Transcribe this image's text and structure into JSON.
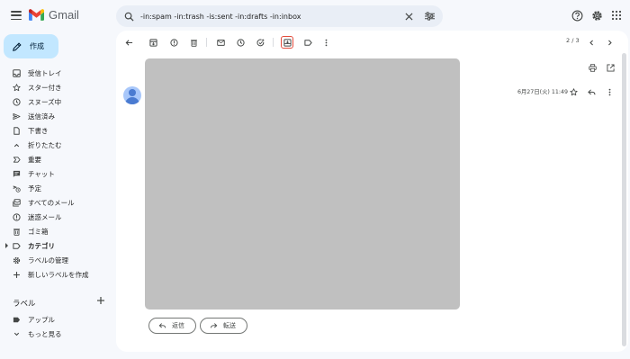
{
  "app": {
    "name": "Gmail"
  },
  "search": {
    "query": "-in:spam -in:trash -is:sent -in:drafts -in:inbox"
  },
  "compose": {
    "label": "作成"
  },
  "sidebar": {
    "items": [
      {
        "label": "受信トレイ",
        "icon": "inbox-icon"
      },
      {
        "label": "スター付き",
        "icon": "star-icon"
      },
      {
        "label": "スヌーズ中",
        "icon": "clock-icon"
      },
      {
        "label": "送信済み",
        "icon": "send-icon"
      },
      {
        "label": "下書き",
        "icon": "draft-icon"
      },
      {
        "label": "折りたたむ",
        "icon": "chevron-up-icon"
      },
      {
        "label": "重要",
        "icon": "important-icon"
      },
      {
        "label": "チャット",
        "icon": "chat-icon"
      },
      {
        "label": "予定",
        "icon": "scheduled-icon"
      },
      {
        "label": "すべてのメール",
        "icon": "all-mail-icon"
      },
      {
        "label": "迷惑メール",
        "icon": "spam-icon"
      },
      {
        "label": "ゴミ箱",
        "icon": "trash-icon"
      },
      {
        "label": "カテゴリ",
        "icon": "label-icon",
        "bold": true
      },
      {
        "label": "ラベルの管理",
        "icon": "gear-icon"
      },
      {
        "label": "新しいラベルを作成",
        "icon": "plus-icon"
      }
    ],
    "labels_header": "ラベル",
    "labels": [
      {
        "label": "アップル",
        "icon": "label-filled-icon"
      },
      {
        "label": "もっと見る",
        "icon": "chevron-down-icon"
      }
    ]
  },
  "message": {
    "pager": "2 / 3",
    "date": "6月27日(火) 11:49"
  },
  "actions": {
    "reply": "返信",
    "forward": "転送"
  },
  "colors": {
    "compose_bg": "#c2e7ff",
    "search_bg": "#e9eef6",
    "highlight": "#e34b3b",
    "image_placeholder": "#c0c0c0"
  }
}
